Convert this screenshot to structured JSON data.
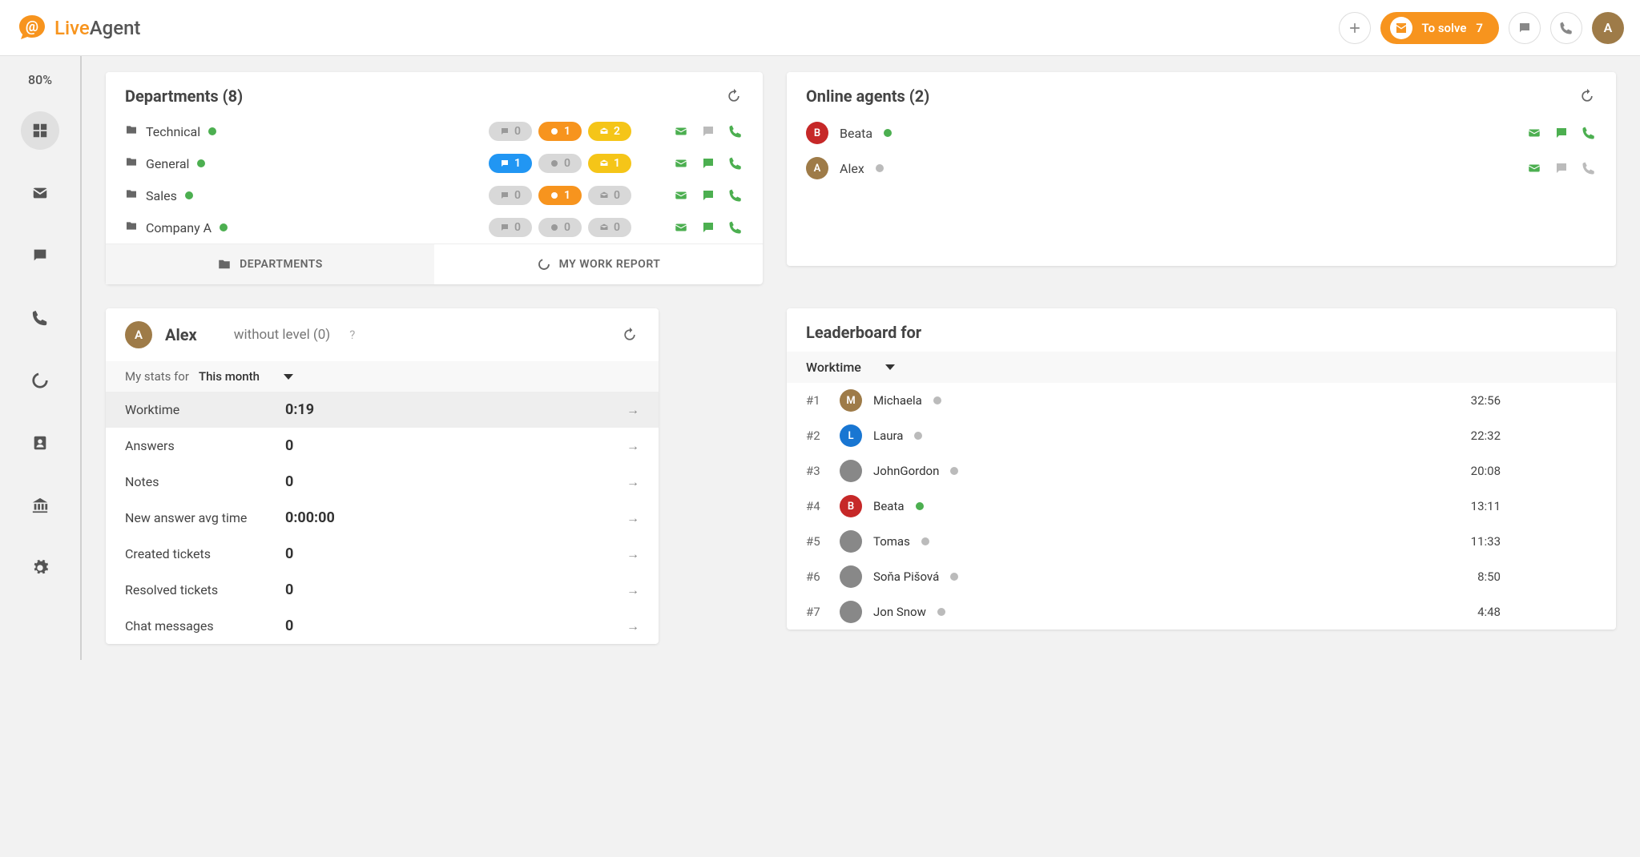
{
  "header": {
    "brand_live": "Live",
    "brand_agent": "Agent",
    "to_solve_label": "To solve",
    "to_solve_count": "7",
    "user_initial": "A"
  },
  "sidebar": {
    "zoom": "80%"
  },
  "departments": {
    "title": "Departments (8)",
    "tabs": {
      "departments": "DEPARTMENTS",
      "mywork": "MY WORK REPORT"
    },
    "rows": [
      {
        "name": "Technical",
        "online": true,
        "chat": "0",
        "chat_color": "gray",
        "new": "1",
        "new_color": "orange",
        "open": "2",
        "open_color": "yellow",
        "mail": "green",
        "msg": "gray",
        "phone": "green"
      },
      {
        "name": "General",
        "online": true,
        "chat": "1",
        "chat_color": "blue",
        "new": "0",
        "new_color": "gray",
        "open": "1",
        "open_color": "yellow",
        "mail": "green",
        "msg": "green",
        "phone": "green"
      },
      {
        "name": "Sales",
        "online": true,
        "chat": "0",
        "chat_color": "gray",
        "new": "1",
        "new_color": "orange",
        "open": "0",
        "open_color": "gray",
        "mail": "green",
        "msg": "green",
        "phone": "green"
      },
      {
        "name": "Company A",
        "online": true,
        "chat": "0",
        "chat_color": "gray",
        "new": "0",
        "new_color": "gray",
        "open": "0",
        "open_color": "gray",
        "mail": "green",
        "msg": "green",
        "phone": "green"
      }
    ]
  },
  "online_agents": {
    "title": "Online agents (2)",
    "rows": [
      {
        "initial": "B",
        "color": "red",
        "name": "Beata",
        "online": true,
        "mail": "green",
        "msg": "green",
        "phone": "green"
      },
      {
        "initial": "A",
        "color": "brown",
        "name": "Alex",
        "online": false,
        "mail": "green",
        "msg": "gray",
        "phone": "gray"
      }
    ]
  },
  "mystats": {
    "user_initial": "A",
    "user_name": "Alex",
    "level_text": "without level (0)",
    "help": "?",
    "filter_label": "My stats for",
    "filter_value": "This month",
    "rows": [
      {
        "label": "Worktime",
        "value": "0:19",
        "highlight": true
      },
      {
        "label": "Answers",
        "value": "0"
      },
      {
        "label": "Notes",
        "value": "0"
      },
      {
        "label": "New answer avg time",
        "value": "0:00:00"
      },
      {
        "label": "Created tickets",
        "value": "0"
      },
      {
        "label": "Resolved tickets",
        "value": "0"
      },
      {
        "label": "Chat messages",
        "value": "0"
      }
    ]
  },
  "leaderboard": {
    "title": "Leaderboard for",
    "filter_value": "Worktime",
    "rows": [
      {
        "rank": "#1",
        "initial": "M",
        "color": "brown",
        "name": "Michaela",
        "online": false,
        "time": "32:56"
      },
      {
        "rank": "#2",
        "initial": "L",
        "color": "blue",
        "name": "Laura",
        "online": false,
        "time": "22:32"
      },
      {
        "rank": "#3",
        "initial": "",
        "color": "img",
        "name": "JohnGordon",
        "online": false,
        "time": "20:08"
      },
      {
        "rank": "#4",
        "initial": "B",
        "color": "red",
        "name": "Beata",
        "online": true,
        "time": "13:11"
      },
      {
        "rank": "#5",
        "initial": "",
        "color": "img",
        "name": "Tomas",
        "online": false,
        "time": "11:33"
      },
      {
        "rank": "#6",
        "initial": "",
        "color": "img",
        "name": "Soňa Pišová",
        "online": false,
        "time": "8:50"
      },
      {
        "rank": "#7",
        "initial": "",
        "color": "img",
        "name": "Jon Snow",
        "online": false,
        "time": "4:48"
      }
    ]
  }
}
